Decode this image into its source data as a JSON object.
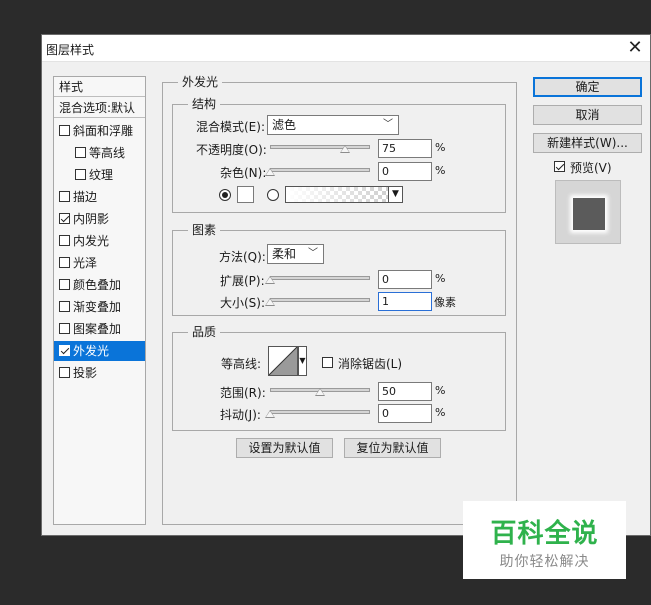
{
  "window": {
    "title": "图层样式"
  },
  "style_list": {
    "header_styles": "样式",
    "header_blending": "混合选项:默认",
    "items": [
      {
        "label": "斜面和浮雕",
        "checked": false,
        "indent": false
      },
      {
        "label": "等高线",
        "checked": false,
        "indent": true
      },
      {
        "label": "纹理",
        "checked": false,
        "indent": true
      },
      {
        "label": "描边",
        "checked": false,
        "indent": false
      },
      {
        "label": "内阴影",
        "checked": true,
        "indent": false
      },
      {
        "label": "内发光",
        "checked": false,
        "indent": false
      },
      {
        "label": "光泽",
        "checked": false,
        "indent": false
      },
      {
        "label": "颜色叠加",
        "checked": false,
        "indent": false
      },
      {
        "label": "渐变叠加",
        "checked": false,
        "indent": false
      },
      {
        "label": "图案叠加",
        "checked": false,
        "indent": false
      },
      {
        "label": "外发光",
        "checked": true,
        "indent": false,
        "active": true
      },
      {
        "label": "投影",
        "checked": false,
        "indent": false
      }
    ]
  },
  "outer_glow": {
    "title": "外发光",
    "structure": {
      "title": "结构",
      "blend_mode_label": "混合模式(E):",
      "blend_mode_value": "滤色",
      "opacity_label": "不透明度(O):",
      "opacity_value": "75",
      "opacity_fraction": 0.75,
      "noise_label": "杂色(N):",
      "noise_value": "0",
      "noise_fraction": 0,
      "percent": "%"
    },
    "elements": {
      "title": "图素",
      "technique_label": "方法(Q):",
      "technique_value": "柔和",
      "spread_label": "扩展(P):",
      "spread_value": "0",
      "spread_fraction": 0,
      "size_label": "大小(S):",
      "size_value": "1",
      "size_fraction": 0,
      "percent": "%",
      "pixels": "像素"
    },
    "quality": {
      "title": "品质",
      "contour_label": "等高线:",
      "antialias_label": "消除锯齿(L)",
      "range_label": "范围(R):",
      "range_value": "50",
      "range_fraction": 0.5,
      "jitter_label": "抖动(J):",
      "jitter_value": "0",
      "jitter_fraction": 0,
      "percent": "%"
    },
    "make_default": "设置为默认值",
    "reset_default": "复位为默认值"
  },
  "buttons": {
    "ok": "确定",
    "cancel": "取消",
    "new_style": "新建样式(W)...",
    "preview_label": "预览(V)"
  },
  "watermark": {
    "main": "百科全说",
    "sub": "助你轻松解决"
  },
  "colors": {
    "accent": "#0a74d9",
    "watermark_green": "#2fb24c"
  }
}
